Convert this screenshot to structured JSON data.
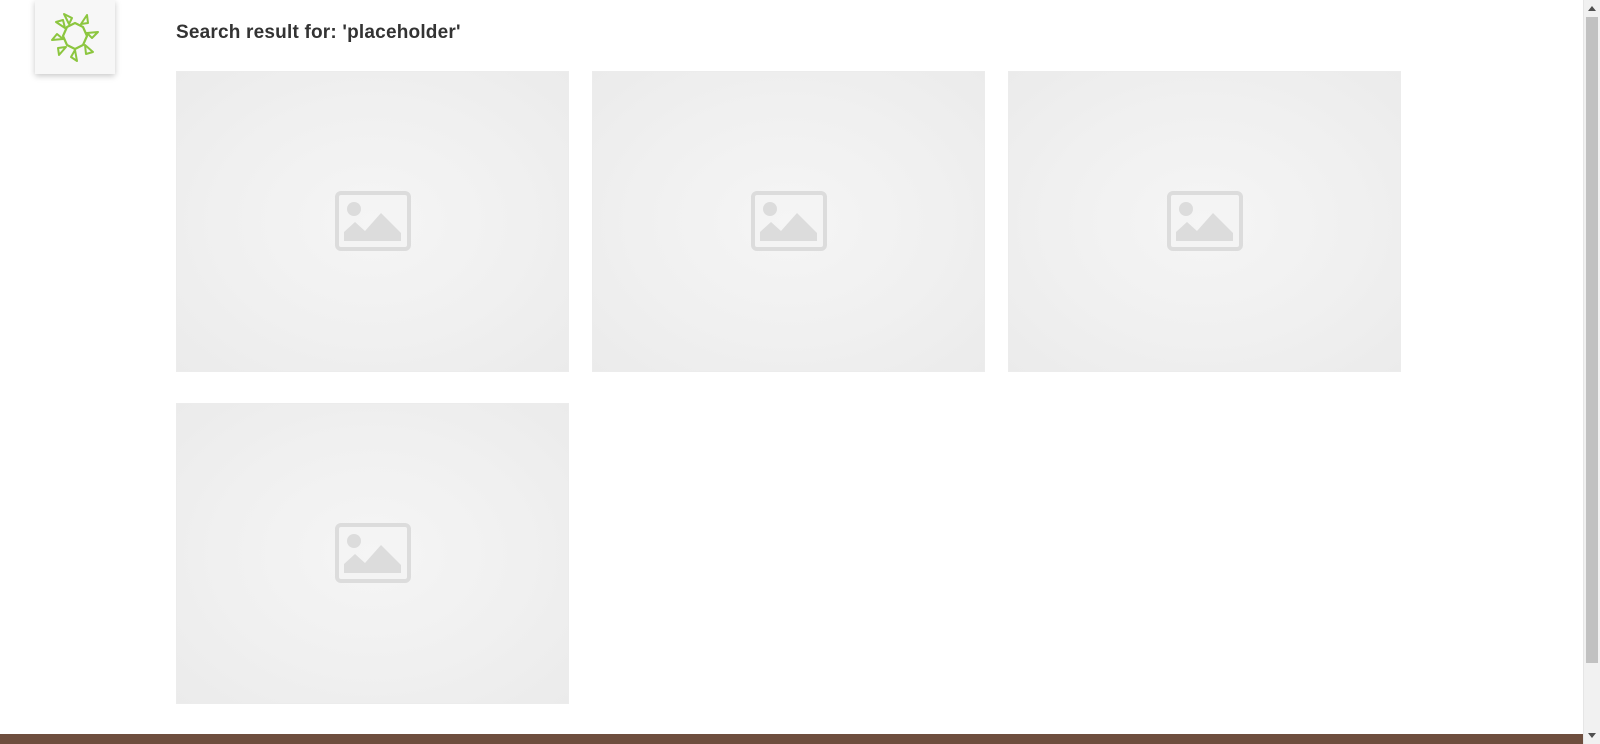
{
  "logo": {
    "icon": "sun-logo-icon",
    "color": "#8cc63f"
  },
  "search": {
    "title": "Search result for: 'placeholder'"
  },
  "results": [
    {
      "icon": "image-placeholder-icon"
    },
    {
      "icon": "image-placeholder-icon"
    },
    {
      "icon": "image-placeholder-icon"
    },
    {
      "icon": "image-placeholder-icon"
    }
  ],
  "footer": {
    "color": "#6e4e3e"
  },
  "colors": {
    "title_text": "#333333",
    "card_bg": "#f0f0f0",
    "placeholder_icon": "#dcdcdc"
  }
}
